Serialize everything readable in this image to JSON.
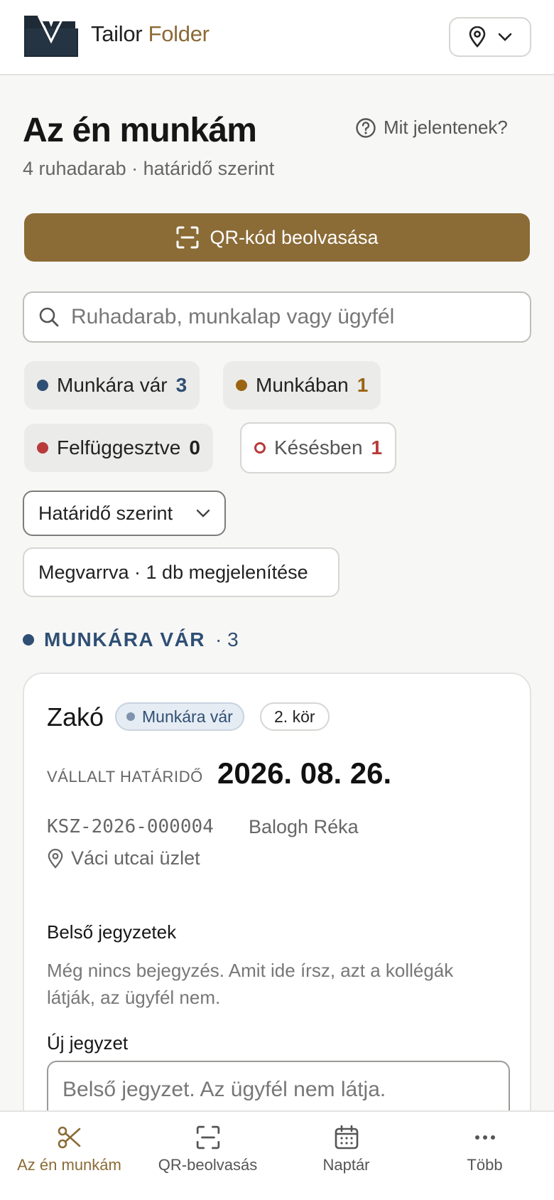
{
  "header": {
    "brand_part1": "Tailor",
    "brand_part2": "Folder",
    "logo_icon": "folder-suit-logo",
    "location_icon": "map-pin-icon",
    "dropdown_icon": "chevron-down-icon"
  },
  "page": {
    "title": "Az én munkám",
    "subtitle": "4 ruhadarab · határidő szerint",
    "help_label": "Mit jelentenek?"
  },
  "qr_button": {
    "label": "QR-kód beolvasása"
  },
  "search": {
    "placeholder": "Ruhadarab, munkalap vagy ügyfél"
  },
  "filters": [
    {
      "label": "Munkára vár",
      "count": "3",
      "color": "#2f4f74"
    },
    {
      "label": "Munkában",
      "count": "1",
      "color": "#9a6412"
    },
    {
      "label": "Felfüggesztve",
      "count": "0",
      "color": "#b83a3a"
    },
    {
      "label": "Késésben",
      "count": "1",
      "color": "#b83a3a"
    }
  ],
  "sort": {
    "label": "Határidő szerint"
  },
  "show_sewn": {
    "label": "Megvarrva · 1 db megjelenítése"
  },
  "section": {
    "title": "MUNKÁRA VÁR",
    "count": "· 3"
  },
  "card": {
    "title": "Zakó",
    "status": "Munkára vár",
    "round": "2. kör",
    "deadline_label": "VÁLLALT HATÁRIDŐ",
    "deadline": "2026. 08. 26.",
    "code": "KSZ-2026-000004",
    "client": "Balogh Réka",
    "shop": "Váci utcai üzlet",
    "notes_heading": "Belső jegyzetek",
    "notes_empty": "Még nincs bejegyzés. Amit ide írsz, azt a kollégák látják, az ügyfél nem.",
    "new_note_label": "Új jegyzet",
    "new_note_placeholder": "Belső jegyzet. Az ügyfél nem látja."
  },
  "nav": [
    {
      "label": "Az én munkám",
      "icon": "scissors-icon",
      "active": true
    },
    {
      "label": "QR-beolvasás",
      "icon": "qr-scan-icon",
      "active": false
    },
    {
      "label": "Naptár",
      "icon": "calendar-icon",
      "active": false
    },
    {
      "label": "Több",
      "icon": "more-dots-icon",
      "active": false
    }
  ],
  "colors": {
    "accent": "#8b6b36",
    "status_waiting": "#2f4f74",
    "status_working": "#9a6412",
    "status_late": "#b83a3a"
  }
}
